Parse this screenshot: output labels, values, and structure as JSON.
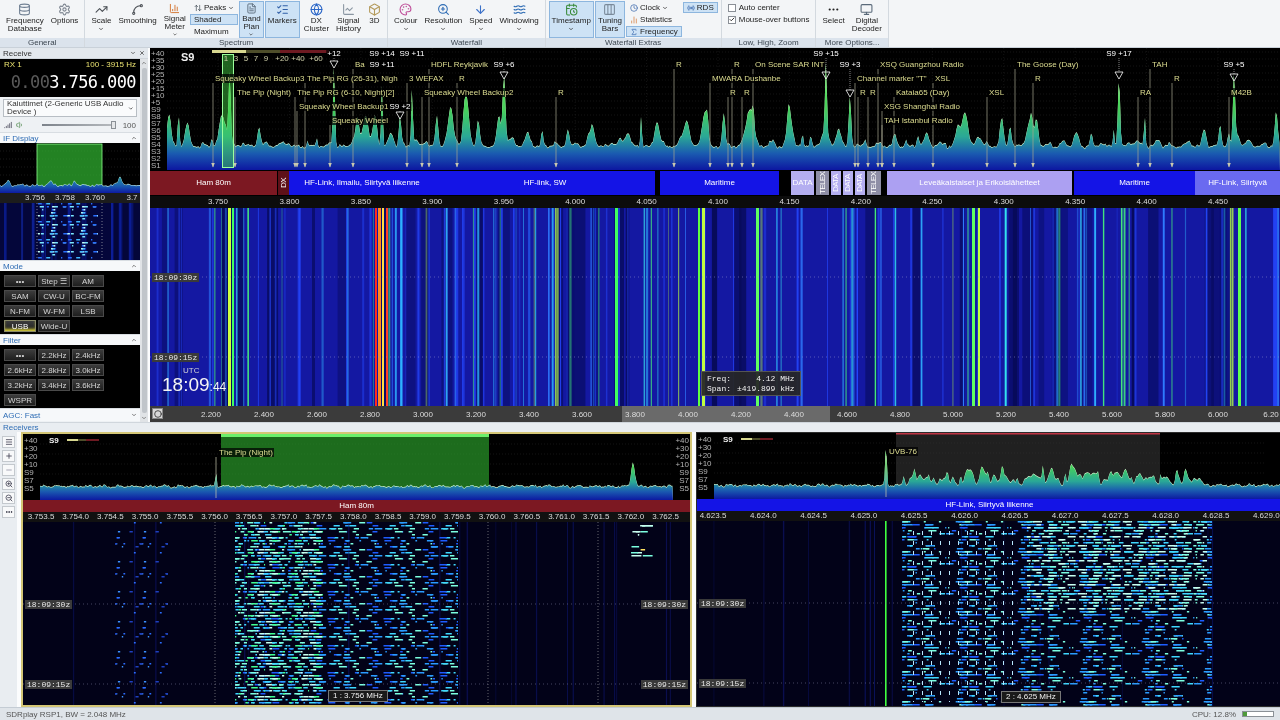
{
  "ribbon": {
    "groups": [
      {
        "label": "General",
        "items": [
          {
            "kind": "large",
            "label": "Frequency Database",
            "dropdown": false,
            "selected": false
          },
          {
            "kind": "large",
            "label": "Options",
            "dropdown": false,
            "selected": false
          }
        ]
      },
      {
        "label": "Spectrum",
        "items": [
          {
            "kind": "large",
            "label": "Scale",
            "dropdown": true,
            "selected": false
          },
          {
            "kind": "large",
            "label": "Smoothing",
            "dropdown": false,
            "selected": false
          },
          {
            "kind": "large",
            "label": "Signal Meter",
            "dropdown": true,
            "selected": false
          },
          {
            "kind": "stack",
            "rows": [
              {
                "kind": "button",
                "label": "Peaks",
                "dropdown": true,
                "selected": false
              },
              {
                "kind": "button",
                "label": "Shaded",
                "dropdown": false,
                "selected": true
              },
              {
                "kind": "button",
                "label": "Maximum",
                "dropdown": false,
                "selected": false
              }
            ]
          },
          {
            "kind": "large",
            "label": "Band Plan",
            "dropdown": true,
            "selected": true
          },
          {
            "kind": "large",
            "label": "Markers",
            "dropdown": false,
            "selected": true
          },
          {
            "kind": "large",
            "label": "DX Cluster",
            "dropdown": false,
            "selected": false
          },
          {
            "kind": "large",
            "label": "Signal History",
            "dropdown": false,
            "selected": false
          },
          {
            "kind": "large",
            "label": "3D",
            "dropdown": false,
            "selected": false
          }
        ]
      },
      {
        "label": "Waterfall",
        "items": [
          {
            "kind": "large",
            "label": "Colour",
            "dropdown": true,
            "selected": false
          },
          {
            "kind": "large",
            "label": "Resolution",
            "dropdown": true,
            "selected": false
          },
          {
            "kind": "large",
            "label": "Speed",
            "dropdown": true,
            "selected": false
          },
          {
            "kind": "large",
            "label": "Windowing",
            "dropdown": true,
            "selected": false
          }
        ]
      },
      {
        "label": "Waterfall Extras",
        "items": [
          {
            "kind": "large",
            "label": "Timestamp",
            "dropdown": true,
            "selected": true
          },
          {
            "kind": "large",
            "label": "Tuning Bars",
            "dropdown": false,
            "selected": true
          },
          {
            "kind": "stack",
            "rows": [
              {
                "kind": "button",
                "label": "Clock",
                "dropdown": true,
                "selected": false
              },
              {
                "kind": "button",
                "label": "Statistics",
                "dropdown": false,
                "selected": false
              },
              {
                "kind": "button",
                "label": "Frequency",
                "dropdown": false,
                "selected": true
              }
            ]
          },
          {
            "kind": "stack",
            "rows": [
              {
                "kind": "button",
                "label": "RDS",
                "dropdown": false,
                "selected": true
              }
            ]
          }
        ]
      },
      {
        "label": "Low, High, Zoom",
        "items": [
          {
            "kind": "stack",
            "rows": [
              {
                "kind": "check",
                "label": "Auto center",
                "checked": false
              },
              {
                "kind": "check",
                "label": "Mouse-over buttons",
                "checked": true
              }
            ]
          }
        ]
      },
      {
        "label": "More Options...",
        "items": [
          {
            "kind": "large",
            "label": "Select",
            "dropdown": false,
            "selected": false
          },
          {
            "kind": "large",
            "label": "Digital Decoder",
            "dropdown": false,
            "selected": false
          }
        ]
      }
    ]
  },
  "receive_panel": {
    "title": "Receive",
    "rx_label": "RX 1",
    "bandwidth": "100 - 3915 Hz",
    "frequency": {
      "dim": "0.00",
      "value": "3.756.000"
    },
    "audio_device": "Kaiuttimet (2-Generic USB Audio Device )",
    "volume": {
      "level": 1,
      "reading": "100"
    },
    "if_display": {
      "title": "IF Display",
      "ticks": [
        "3.756",
        "3.758",
        "3.760",
        "3.7"
      ]
    },
    "mode": {
      "title": "Mode",
      "buttons": [
        {
          "label": "•••",
          "selected": false
        },
        {
          "label": "Step ☰",
          "selected": false
        },
        {
          "label": "AM",
          "selected": false
        },
        {
          "label": "SAM",
          "selected": false
        },
        {
          "label": "CW-U",
          "selected": false
        },
        {
          "label": "BC-FM",
          "selected": false
        },
        {
          "label": "N-FM",
          "selected": false
        },
        {
          "label": "W-FM",
          "selected": false
        },
        {
          "label": "LSB",
          "selected": false
        },
        {
          "label": "USB",
          "selected": true
        },
        {
          "label": "Wide-U",
          "selected": false
        }
      ]
    },
    "filter": {
      "title": "Filter",
      "buttons": [
        {
          "label": "•••",
          "selected": false
        },
        {
          "label": "2.2kHz",
          "selected": false
        },
        {
          "label": "2.4kHz",
          "selected": false
        },
        {
          "label": "2.6kHz",
          "selected": false
        },
        {
          "label": "2.8kHz",
          "selected": false
        },
        {
          "label": "3.0kHz",
          "selected": false
        },
        {
          "label": "3.2kHz",
          "selected": false
        },
        {
          "label": "3.4kHz",
          "selected": false
        },
        {
          "label": "3.6kHz",
          "selected": false
        },
        {
          "label": "WSPR",
          "selected": false
        }
      ]
    },
    "agc": "AGC: Fast"
  },
  "spectrum": {
    "s_meter": {
      "reading": "S9",
      "level": 0.29,
      "scale": [
        "1",
        "3",
        "5",
        "7",
        "9",
        "+20",
        "+40",
        "+60"
      ]
    },
    "db_labels": [
      "+40",
      "+35",
      "+30",
      "+25",
      "+20",
      "+15",
      "+10",
      "+5",
      "S9",
      "S8",
      "S7",
      "S6",
      "S5",
      "S4",
      "S3",
      "S2",
      "S1"
    ],
    "markers": [
      {
        "kind": "peak",
        "label": "+12"
      },
      {
        "kind": "peak",
        "label": "S9 +14"
      },
      {
        "kind": "peak",
        "label": "S9 +11"
      },
      {
        "kind": "peak",
        "label": "S9 +15"
      },
      {
        "kind": "peak",
        "label": "S9 +17"
      },
      {
        "kind": "station",
        "label": "Ba"
      },
      {
        "kind": "peak",
        "label": "S9 +11"
      },
      {
        "kind": "station",
        "label": "HDFL Reykjavik"
      },
      {
        "kind": "peak",
        "label": "S9 +6"
      },
      {
        "kind": "station",
        "label": "R"
      },
      {
        "kind": "station",
        "label": "R"
      },
      {
        "kind": "station",
        "label": "On Scene SAR INT"
      },
      {
        "kind": "peak",
        "label": "S9 +3"
      },
      {
        "kind": "station",
        "label": "XSQ Guangzhou Radio"
      },
      {
        "kind": "station",
        "label": "The Goose (Day)"
      },
      {
        "kind": "station",
        "label": "TAH"
      },
      {
        "kind": "peak",
        "label": "S9 +5"
      },
      {
        "kind": "station",
        "label": "Squeaky Wheel Backup3"
      },
      {
        "kind": "station",
        "label": "The Pip RG (26-31), Nigh"
      },
      {
        "kind": "station",
        "label": "3 WEFAX"
      },
      {
        "kind": "station",
        "label": "R"
      },
      {
        "kind": "station",
        "label": "MWARA Dushanbe"
      },
      {
        "kind": "station",
        "label": "Channel marker \"T\""
      },
      {
        "kind": "station",
        "label": "XSL"
      },
      {
        "kind": "station",
        "label": "R"
      },
      {
        "kind": "station",
        "label": "R"
      },
      {
        "kind": "station",
        "label": "The Pip (Night)"
      },
      {
        "kind": "station",
        "label": "The Pip RG (6-10, Night)[2]"
      },
      {
        "kind": "station",
        "label": "Squeaky Wheel Backup2"
      },
      {
        "kind": "station",
        "label": "R"
      },
      {
        "kind": "station",
        "label": "R"
      },
      {
        "kind": "station",
        "label": "R"
      },
      {
        "kind": "station",
        "label": "R"
      },
      {
        "kind": "station",
        "label": "R"
      },
      {
        "kind": "station",
        "label": "Kataia65 (Day)"
      },
      {
        "kind": "station",
        "label": "XSL"
      },
      {
        "kind": "station",
        "label": "RA"
      },
      {
        "kind": "station",
        "label": "M42B"
      },
      {
        "kind": "station",
        "label": "Squeaky Wheel Backup1"
      },
      {
        "kind": "peak",
        "label": "S9 +2"
      },
      {
        "kind": "station",
        "label": "XSG Shanghai Radio"
      },
      {
        "kind": "station",
        "label": "Squeaky Wheel"
      },
      {
        "kind": "station",
        "label": "TAH Istanbul Radio"
      }
    ],
    "band_plan": [
      {
        "kind": "horizontal",
        "label": "Ham 80m",
        "color": "#7c1822"
      },
      {
        "kind": "vertical",
        "label": "DX",
        "color": "#5e1018"
      },
      {
        "kind": "horizontal",
        "label": "HF-Link, Ilmailu, Siirtyvä liikenne",
        "color": "#1414e6"
      },
      {
        "kind": "horizontal",
        "label": "HF-link, SW",
        "color": "#1414e6"
      },
      {
        "kind": "horizontal",
        "label": "Maritime",
        "color": "#1414e6"
      },
      {
        "kind": "horizontal",
        "label": "DATA",
        "color": "#b4aef0"
      },
      {
        "kind": "vertical",
        "label": "TELEX",
        "color": "#8e8ea6"
      },
      {
        "kind": "vertical",
        "label": "DATA",
        "color": "#b4aef0"
      },
      {
        "kind": "vertical",
        "label": "DATA",
        "color": "#b4aef0"
      },
      {
        "kind": "vertical",
        "label": "DATA",
        "color": "#b4aef0"
      },
      {
        "kind": "vertical",
        "label": "TELEX",
        "color": "#8e8ea6"
      },
      {
        "kind": "horizontal",
        "label": "Leveäkaistaiset ja Erikoislähetteet",
        "color": "#aca0f2"
      },
      {
        "kind": "horizontal",
        "label": "Maritime",
        "color": "#1414e6"
      },
      {
        "kind": "horizontal",
        "label": "HF-Link, Siirtyvä",
        "color": "#6a6af0"
      }
    ],
    "ticks": [
      "3.750",
      "3.800",
      "3.850",
      "3.900",
      "3.950",
      "4.000",
      "4.050",
      "4.100",
      "4.150",
      "4.200",
      "4.250",
      "4.300",
      "4.350",
      "4.400",
      "4.450"
    ]
  },
  "waterfall": {
    "timestamps": [
      "18:09:30z",
      "18:09:15z"
    ],
    "clock": {
      "zone": "UTC",
      "time": "18:09",
      "seconds": ":44"
    },
    "tooltip": {
      "freq_label": "Freq:",
      "freq": "4.12 MHz",
      "span_label": "Span:",
      "span": "±419.899 kHz"
    },
    "overview_ticks": [
      "2.200",
      "2.400",
      "2.600",
      "2.800",
      "3.000",
      "3.200",
      "3.400",
      "3.600",
      "3.800",
      "4.000",
      "4.200",
      "4.400",
      "4.600",
      "4.800",
      "5.000",
      "5.200",
      "5.400",
      "5.600",
      "5.800",
      "6.000",
      "6.20"
    ]
  },
  "receivers": {
    "title": "Receivers",
    "panels": [
      {
        "selected": true,
        "s_meter": {
          "reading": "S9",
          "level": 0.35
        },
        "db_labels_left": [
          "+40",
          "+30",
          "+20",
          "+10",
          "S9",
          "S7",
          "S5"
        ],
        "db_labels_right": [
          "+40",
          "+30",
          "+20",
          "+10",
          "S9",
          "S7",
          "S5"
        ],
        "marker": "The Pip (Night)",
        "band": {
          "label": "Ham 80m",
          "color": "#7c1822"
        },
        "ticks": [
          "3.753.5",
          "3.754.0",
          "3.754.5",
          "3.755.0",
          "3.755.5",
          "3.756.0",
          "3.756.5",
          "3.757.0",
          "3.757.5",
          "3.758.0",
          "3.758.5",
          "3.759.0",
          "3.759.5",
          "3.760.0",
          "3.760.5",
          "3.761.0",
          "3.761.5",
          "3.762.0",
          "3.762.5"
        ],
        "timestamps_left": [
          "18:09:30z",
          "18:09:15z"
        ],
        "timestamps_right": [
          "18:09:30z",
          "18:09:15z"
        ],
        "tuning_label": "1 : 3.756 MHz"
      },
      {
        "selected": false,
        "s_meter": {
          "reading": "S9",
          "level": 0.35
        },
        "db_labels_left": [
          "+40",
          "+30",
          "+20",
          "+10",
          "S9",
          "S7",
          "S5"
        ],
        "marker": "UVB-76",
        "band": {
          "label": "HF-Link, Siirtyvä liikenne",
          "color": "#1414e6"
        },
        "ticks": [
          "4.623.5",
          "4.624.0",
          "4.624.5",
          "4.625.0",
          "4.625.5",
          "4.626.0",
          "4.626.5",
          "4.627.0",
          "4.627.5",
          "4.628.0",
          "4.628.5",
          "4.629.0"
        ],
        "timestamps_left": [
          "18:09:30z",
          "18:09:15z"
        ],
        "tuning_label": "2 : 4.625 MHz"
      }
    ]
  },
  "status_bar": {
    "device": "SDRplay RSP1, BW = 2.048 MHz",
    "cpu": {
      "reading": "CPU: 12.8%",
      "level": 0.13
    }
  }
}
